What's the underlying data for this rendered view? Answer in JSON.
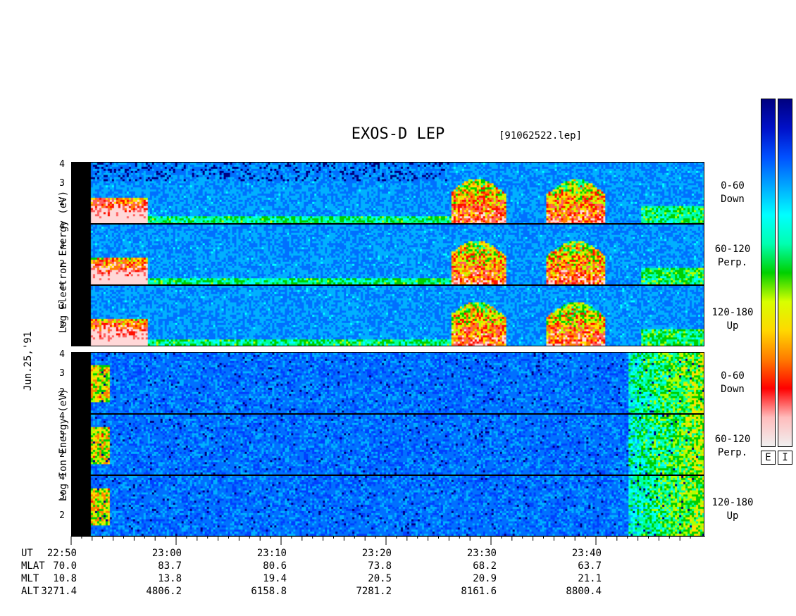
{
  "header": {
    "title": "EXOS-D LEP",
    "filename": "[91062522.lep]"
  },
  "labels": {
    "date": "Jun.25,'91",
    "electron_axis": "Log Electron Energy (eV)",
    "ion_axis": "Log Ion Energy (eV)"
  },
  "colorbar": {
    "e_label": "E",
    "i_label": "I",
    "stops": [
      "#f0f0f0",
      "#ffbcbc",
      "#ff0000",
      "#ff7a00",
      "#ffd800",
      "#d8ff00",
      "#00d000",
      "#00ffb0",
      "#00ffff",
      "#00a8ff",
      "#0050ff",
      "#0010c8",
      "#000080"
    ]
  },
  "chart_data": {
    "type": "heatmap",
    "title": "EXOS-D LEP",
    "y_ticks": [
      "4",
      "3",
      "2"
    ],
    "panels": [
      {
        "species": "Electron",
        "pitch": "0-60",
        "dir": "Down"
      },
      {
        "species": "Electron",
        "pitch": "60-120",
        "dir": "Perp."
      },
      {
        "species": "Electron",
        "pitch": "120-180",
        "dir": "Up"
      },
      {
        "species": "Ion",
        "pitch": "0-60",
        "dir": "Down"
      },
      {
        "species": "Ion",
        "pitch": "60-120",
        "dir": "Perp."
      },
      {
        "species": "Ion",
        "pitch": "120-180",
        "dir": "Up"
      }
    ],
    "x_axis": {
      "rows": [
        {
          "name": "UT",
          "values": [
            "22:50",
            "23:00",
            "23:10",
            "23:20",
            "23:30",
            "23:40"
          ]
        },
        {
          "name": "MLAT",
          "values": [
            "70.0",
            "83.7",
            "80.6",
            "73.8",
            "68.2",
            "63.7"
          ]
        },
        {
          "name": "MLT",
          "values": [
            "10.8",
            "13.8",
            "19.4",
            "20.5",
            "20.9",
            "21.1"
          ]
        },
        {
          "name": "ALT",
          "values": [
            "3271.4",
            "4806.2",
            "6158.8",
            "7281.2",
            "8161.6",
            "8800.4"
          ]
        }
      ]
    }
  }
}
